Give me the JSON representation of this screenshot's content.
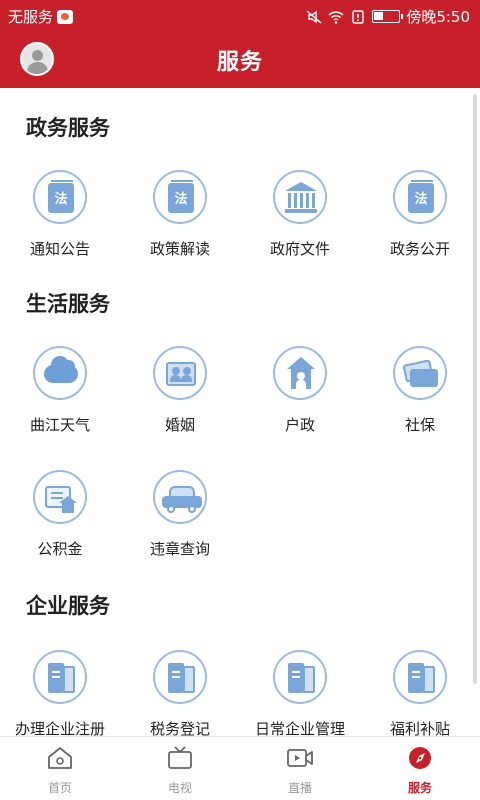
{
  "status_bar": {
    "carrier": "无服务",
    "time": "傍晚5:50"
  },
  "header": {
    "title": "服务"
  },
  "sections": [
    {
      "title": "政务服务",
      "items": [
        {
          "label": "通知公告",
          "icon": "law-book-icon"
        },
        {
          "label": "政策解读",
          "icon": "law-book-icon"
        },
        {
          "label": "政府文件",
          "icon": "government-building-icon"
        },
        {
          "label": "政务公开",
          "icon": "law-book-icon"
        }
      ]
    },
    {
      "title": "生活服务",
      "items": [
        {
          "label": "曲江天气",
          "icon": "cloud-icon"
        },
        {
          "label": "婚姻",
          "icon": "couple-photo-icon"
        },
        {
          "label": "户政",
          "icon": "household-icon"
        },
        {
          "label": "社保",
          "icon": "cards-icon"
        },
        {
          "label": "公积金",
          "icon": "housing-fund-icon"
        },
        {
          "label": "违章查询",
          "icon": "car-icon"
        }
      ]
    },
    {
      "title": "企业服务",
      "items": [
        {
          "label": "办理企业注册",
          "icon": "binder-icon"
        },
        {
          "label": "税务登记",
          "icon": "binder-icon"
        },
        {
          "label": "日常企业管理",
          "icon": "binder-icon"
        },
        {
          "label": "福利补贴",
          "icon": "binder-icon"
        }
      ]
    }
  ],
  "law_glyph": "法",
  "bottom_nav": [
    {
      "label": "首页",
      "icon": "home-icon",
      "active": false
    },
    {
      "label": "电视",
      "icon": "tv-icon",
      "active": false
    },
    {
      "label": "直播",
      "icon": "live-video-icon",
      "active": false
    },
    {
      "label": "服务",
      "icon": "compass-icon",
      "active": true
    }
  ],
  "colors": {
    "brand_red": "#c7202a",
    "icon_blue": "#7aa6da",
    "icon_ring": "#9bbce0"
  }
}
